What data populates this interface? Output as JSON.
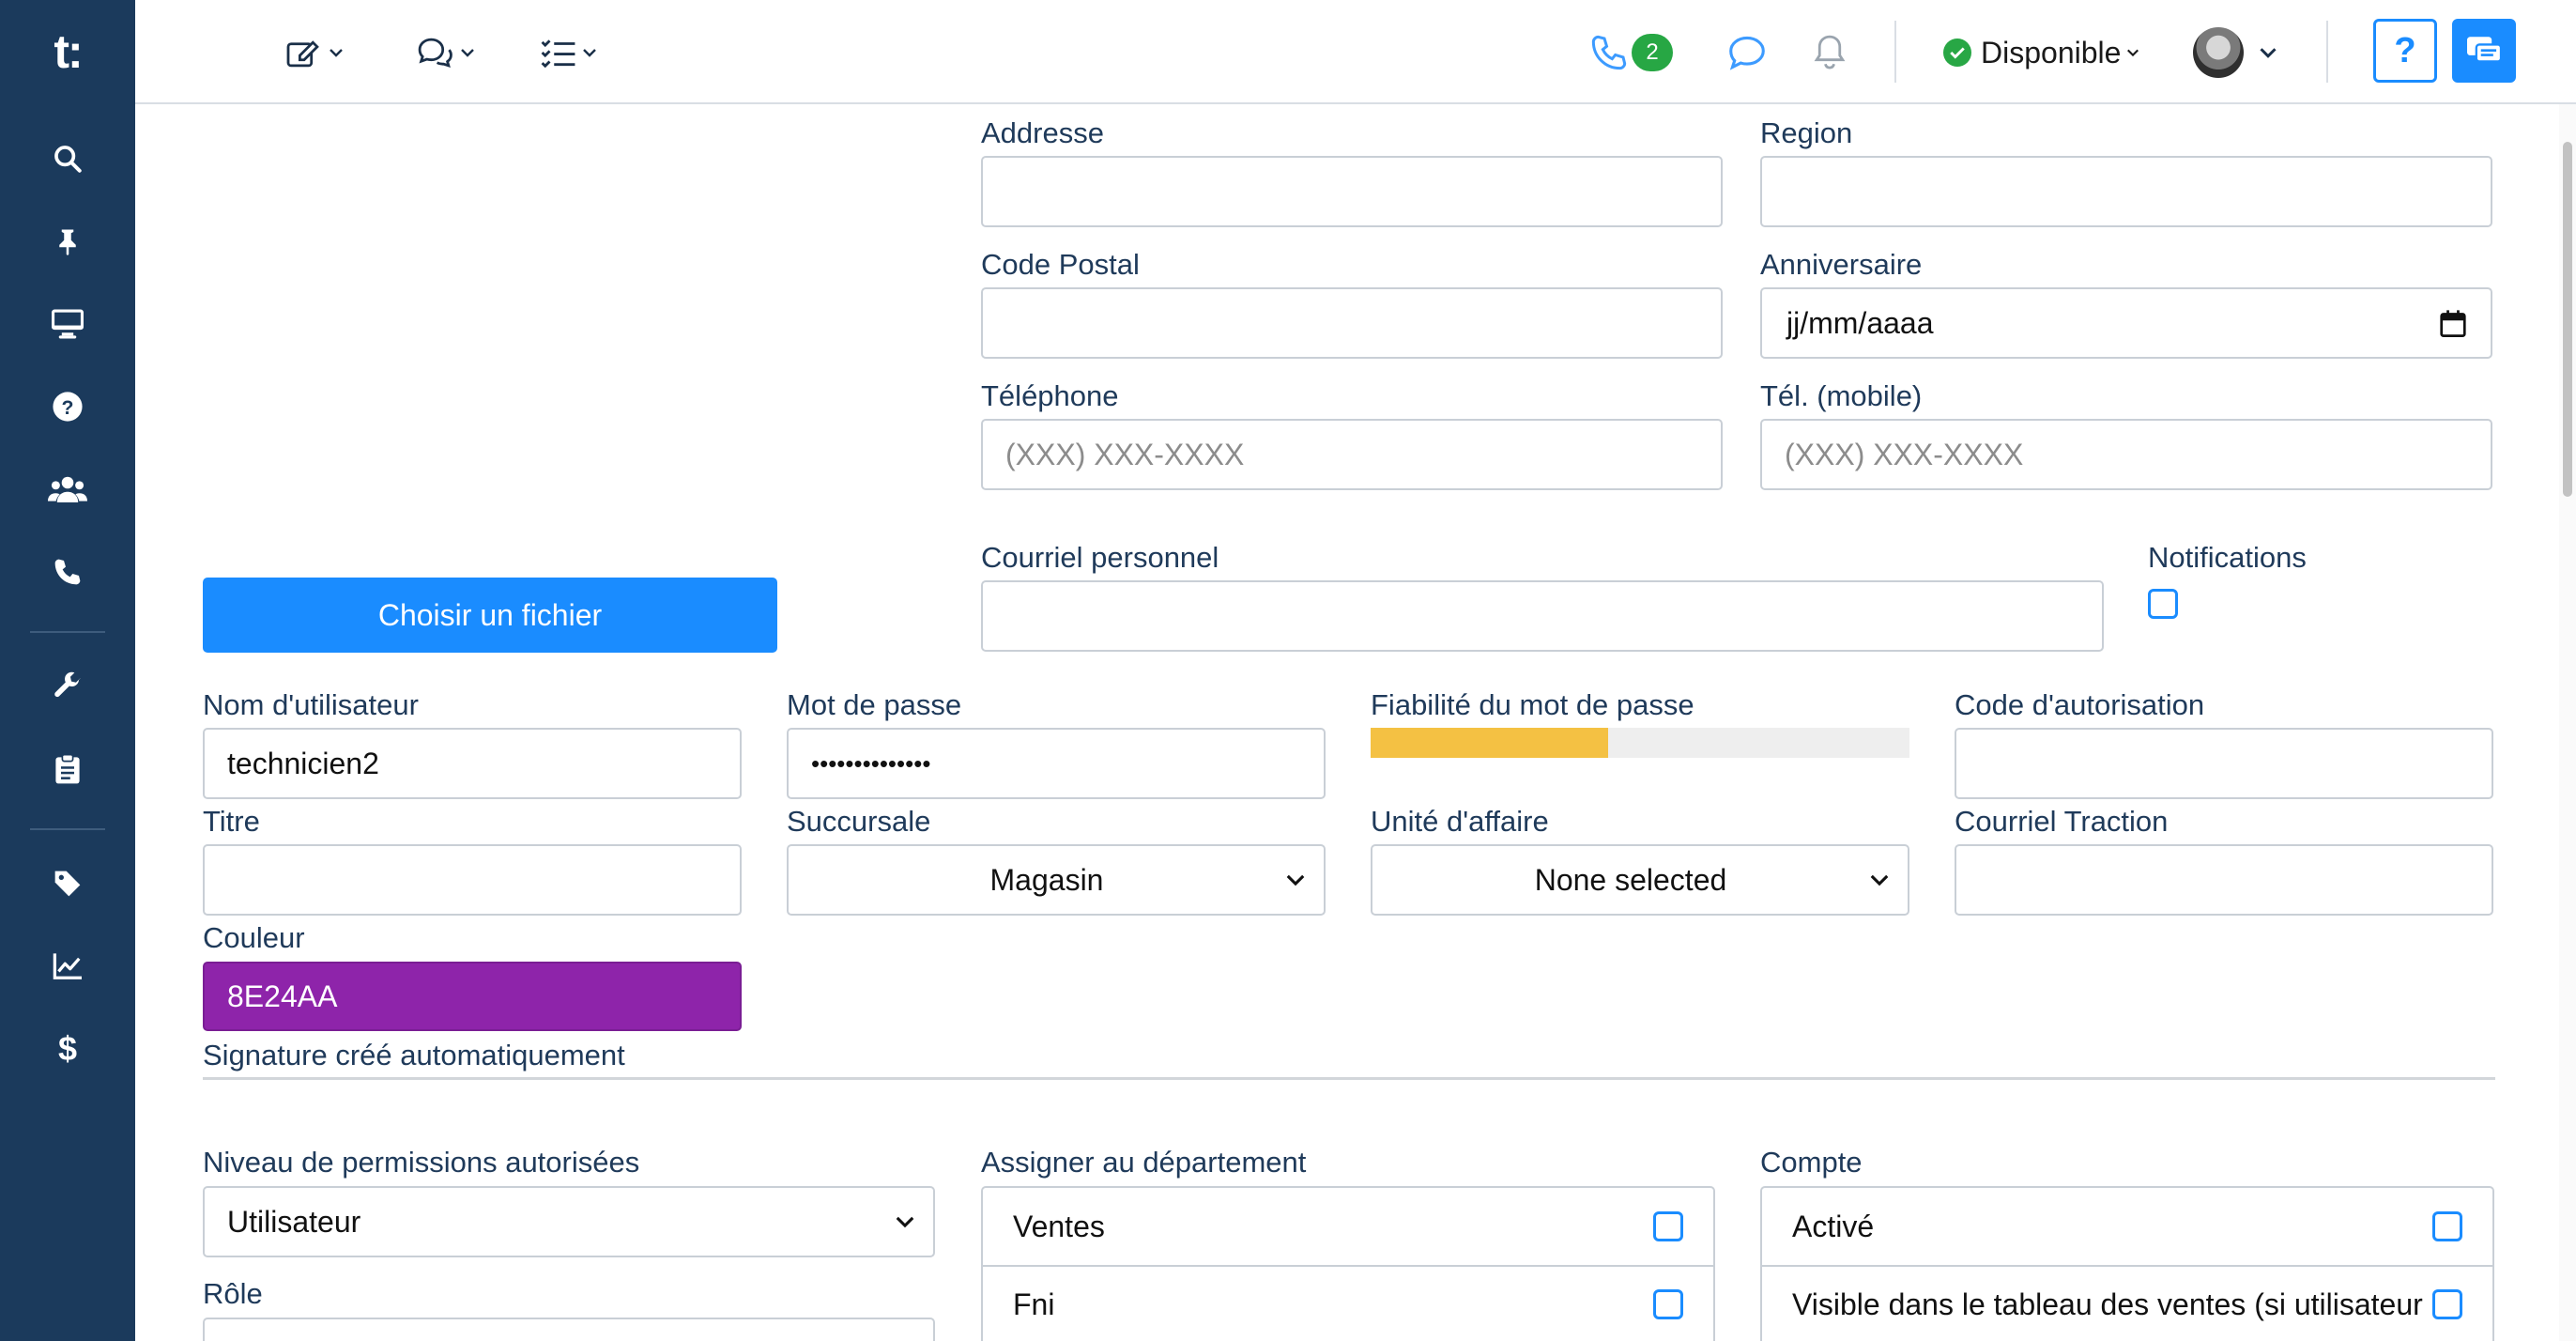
{
  "sidebar": {
    "logo": "t:",
    "items": [
      {
        "icon": "search-icon"
      },
      {
        "icon": "pin-icon"
      },
      {
        "icon": "monitor-icon"
      },
      {
        "icon": "question-circle-icon"
      },
      {
        "icon": "users-icon"
      },
      {
        "icon": "phone-icon"
      },
      {
        "icon": "wrench-icon"
      },
      {
        "icon": "clipboard-icon"
      },
      {
        "icon": "tag-icon"
      },
      {
        "icon": "chart-line-icon"
      },
      {
        "icon": "dollar-icon"
      }
    ]
  },
  "topbar": {
    "phone_badge": "2",
    "status_label": "Disponible",
    "help_label": "?"
  },
  "form": {
    "addresse_label": "Addresse",
    "region_label": "Region",
    "code_postal_label": "Code Postal",
    "anniversaire_label": "Anniversaire",
    "anniversaire_value": "jj/mm/aaaa",
    "telephone_label": "Téléphone",
    "telephone_placeholder": "(XXX) XXX-XXXX",
    "mobile_label": "Tél. (mobile)",
    "mobile_placeholder": "(XXX) XXX-XXXX",
    "file_button": "Choisir un fichier",
    "courriel_perso_label": "Courriel personnel",
    "notifications_label": "Notifications",
    "username_label": "Nom d'utilisateur",
    "username_value": "technicien2",
    "password_label": "Mot de passe",
    "password_value": "••••••••••••••",
    "strength_label": "Fiabilité du mot de passe",
    "strength_fraction": 0.44,
    "auth_code_label": "Code d'autorisation",
    "titre_label": "Titre",
    "succursale_label": "Succursale",
    "succursale_value": "Magasin",
    "unite_label": "Unité d'affaire",
    "unite_value": "None selected",
    "courriel_traction_label": "Courriel Traction",
    "couleur_label": "Couleur",
    "couleur_value": "8E24AA",
    "signature_label": "Signature créé automatiquement",
    "permissions_label": "Niveau de permissions autorisées",
    "permissions_value": "Utilisateur",
    "role_label": "Rôle",
    "departement_label": "Assigner au département",
    "departement_items": [
      "Ventes",
      "Fni"
    ],
    "compte_label": "Compte",
    "compte_items": [
      "Activé",
      "Visible dans le tableau des ventes (si utilisateur"
    ]
  },
  "colors": {
    "sidebar_bg": "#1b3a5c",
    "accent": "#1a8cff",
    "user_color": "#8E24AA",
    "strength_fill": "#f4c143",
    "status_ok": "#28a745"
  }
}
